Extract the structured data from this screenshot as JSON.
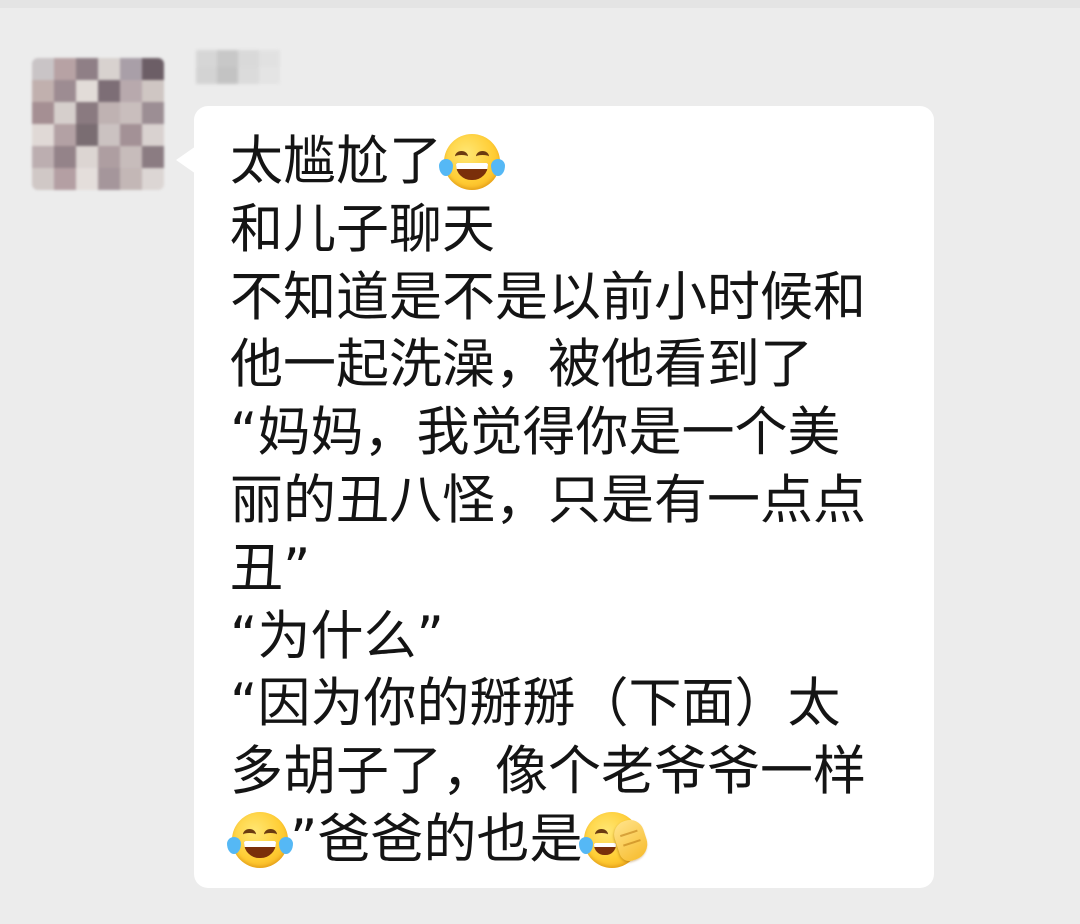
{
  "chat": {
    "sender_name": "",
    "message_lines": [
      [
        {
          "t": "太尴尬了"
        },
        {
          "e": "face-with-tears-of-joy-icon"
        }
      ],
      [
        {
          "t": "和儿子聊天"
        }
      ],
      [
        {
          "t": "不知道是不是以前小时候和"
        }
      ],
      [
        {
          "t": "他一起洗澡，被他看到了"
        }
      ],
      [
        {
          "t": "“妈妈，我觉得你是一个美"
        }
      ],
      [
        {
          "t": "丽的丑八怪，只是有一点点"
        }
      ],
      [
        {
          "t": "丑”"
        }
      ],
      [
        {
          "t": "“为什么”"
        }
      ],
      [
        {
          "t": "“因为你的掰掰（下面）太"
        }
      ],
      [
        {
          "t": "多胡子了，像个老爷爷一样"
        }
      ],
      [
        {
          "e": "face-with-tears-of-joy-icon"
        },
        {
          "t": "”爸爸的也是"
        },
        {
          "e": "facepalm-icon"
        }
      ]
    ]
  },
  "colors": {
    "background": "#ececec",
    "bubble": "#ffffff",
    "text": "#141414"
  }
}
